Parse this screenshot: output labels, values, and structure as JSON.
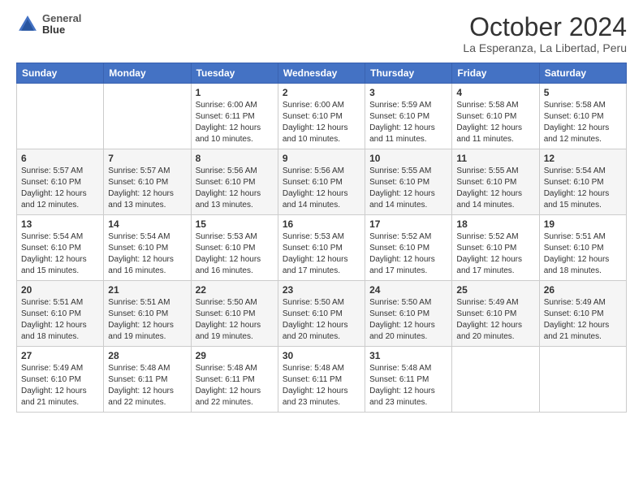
{
  "header": {
    "logo_line1": "General",
    "logo_line2": "Blue",
    "title": "October 2024",
    "subtitle": "La Esperanza, La Libertad, Peru"
  },
  "calendar": {
    "days_of_week": [
      "Sunday",
      "Monday",
      "Tuesday",
      "Wednesday",
      "Thursday",
      "Friday",
      "Saturday"
    ],
    "weeks": [
      [
        {
          "day": "",
          "sunrise": "",
          "sunset": "",
          "daylight": ""
        },
        {
          "day": "",
          "sunrise": "",
          "sunset": "",
          "daylight": ""
        },
        {
          "day": "1",
          "sunrise": "Sunrise: 6:00 AM",
          "sunset": "Sunset: 6:11 PM",
          "daylight": "Daylight: 12 hours and 10 minutes."
        },
        {
          "day": "2",
          "sunrise": "Sunrise: 6:00 AM",
          "sunset": "Sunset: 6:10 PM",
          "daylight": "Daylight: 12 hours and 10 minutes."
        },
        {
          "day": "3",
          "sunrise": "Sunrise: 5:59 AM",
          "sunset": "Sunset: 6:10 PM",
          "daylight": "Daylight: 12 hours and 11 minutes."
        },
        {
          "day": "4",
          "sunrise": "Sunrise: 5:58 AM",
          "sunset": "Sunset: 6:10 PM",
          "daylight": "Daylight: 12 hours and 11 minutes."
        },
        {
          "day": "5",
          "sunrise": "Sunrise: 5:58 AM",
          "sunset": "Sunset: 6:10 PM",
          "daylight": "Daylight: 12 hours and 12 minutes."
        }
      ],
      [
        {
          "day": "6",
          "sunrise": "Sunrise: 5:57 AM",
          "sunset": "Sunset: 6:10 PM",
          "daylight": "Daylight: 12 hours and 12 minutes."
        },
        {
          "day": "7",
          "sunrise": "Sunrise: 5:57 AM",
          "sunset": "Sunset: 6:10 PM",
          "daylight": "Daylight: 12 hours and 13 minutes."
        },
        {
          "day": "8",
          "sunrise": "Sunrise: 5:56 AM",
          "sunset": "Sunset: 6:10 PM",
          "daylight": "Daylight: 12 hours and 13 minutes."
        },
        {
          "day": "9",
          "sunrise": "Sunrise: 5:56 AM",
          "sunset": "Sunset: 6:10 PM",
          "daylight": "Daylight: 12 hours and 14 minutes."
        },
        {
          "day": "10",
          "sunrise": "Sunrise: 5:55 AM",
          "sunset": "Sunset: 6:10 PM",
          "daylight": "Daylight: 12 hours and 14 minutes."
        },
        {
          "day": "11",
          "sunrise": "Sunrise: 5:55 AM",
          "sunset": "Sunset: 6:10 PM",
          "daylight": "Daylight: 12 hours and 14 minutes."
        },
        {
          "day": "12",
          "sunrise": "Sunrise: 5:54 AM",
          "sunset": "Sunset: 6:10 PM",
          "daylight": "Daylight: 12 hours and 15 minutes."
        }
      ],
      [
        {
          "day": "13",
          "sunrise": "Sunrise: 5:54 AM",
          "sunset": "Sunset: 6:10 PM",
          "daylight": "Daylight: 12 hours and 15 minutes."
        },
        {
          "day": "14",
          "sunrise": "Sunrise: 5:54 AM",
          "sunset": "Sunset: 6:10 PM",
          "daylight": "Daylight: 12 hours and 16 minutes."
        },
        {
          "day": "15",
          "sunrise": "Sunrise: 5:53 AM",
          "sunset": "Sunset: 6:10 PM",
          "daylight": "Daylight: 12 hours and 16 minutes."
        },
        {
          "day": "16",
          "sunrise": "Sunrise: 5:53 AM",
          "sunset": "Sunset: 6:10 PM",
          "daylight": "Daylight: 12 hours and 17 minutes."
        },
        {
          "day": "17",
          "sunrise": "Sunrise: 5:52 AM",
          "sunset": "Sunset: 6:10 PM",
          "daylight": "Daylight: 12 hours and 17 minutes."
        },
        {
          "day": "18",
          "sunrise": "Sunrise: 5:52 AM",
          "sunset": "Sunset: 6:10 PM",
          "daylight": "Daylight: 12 hours and 17 minutes."
        },
        {
          "day": "19",
          "sunrise": "Sunrise: 5:51 AM",
          "sunset": "Sunset: 6:10 PM",
          "daylight": "Daylight: 12 hours and 18 minutes."
        }
      ],
      [
        {
          "day": "20",
          "sunrise": "Sunrise: 5:51 AM",
          "sunset": "Sunset: 6:10 PM",
          "daylight": "Daylight: 12 hours and 18 minutes."
        },
        {
          "day": "21",
          "sunrise": "Sunrise: 5:51 AM",
          "sunset": "Sunset: 6:10 PM",
          "daylight": "Daylight: 12 hours and 19 minutes."
        },
        {
          "day": "22",
          "sunrise": "Sunrise: 5:50 AM",
          "sunset": "Sunset: 6:10 PM",
          "daylight": "Daylight: 12 hours and 19 minutes."
        },
        {
          "day": "23",
          "sunrise": "Sunrise: 5:50 AM",
          "sunset": "Sunset: 6:10 PM",
          "daylight": "Daylight: 12 hours and 20 minutes."
        },
        {
          "day": "24",
          "sunrise": "Sunrise: 5:50 AM",
          "sunset": "Sunset: 6:10 PM",
          "daylight": "Daylight: 12 hours and 20 minutes."
        },
        {
          "day": "25",
          "sunrise": "Sunrise: 5:49 AM",
          "sunset": "Sunset: 6:10 PM",
          "daylight": "Daylight: 12 hours and 20 minutes."
        },
        {
          "day": "26",
          "sunrise": "Sunrise: 5:49 AM",
          "sunset": "Sunset: 6:10 PM",
          "daylight": "Daylight: 12 hours and 21 minutes."
        }
      ],
      [
        {
          "day": "27",
          "sunrise": "Sunrise: 5:49 AM",
          "sunset": "Sunset: 6:10 PM",
          "daylight": "Daylight: 12 hours and 21 minutes."
        },
        {
          "day": "28",
          "sunrise": "Sunrise: 5:48 AM",
          "sunset": "Sunset: 6:11 PM",
          "daylight": "Daylight: 12 hours and 22 minutes."
        },
        {
          "day": "29",
          "sunrise": "Sunrise: 5:48 AM",
          "sunset": "Sunset: 6:11 PM",
          "daylight": "Daylight: 12 hours and 22 minutes."
        },
        {
          "day": "30",
          "sunrise": "Sunrise: 5:48 AM",
          "sunset": "Sunset: 6:11 PM",
          "daylight": "Daylight: 12 hours and 23 minutes."
        },
        {
          "day": "31",
          "sunrise": "Sunrise: 5:48 AM",
          "sunset": "Sunset: 6:11 PM",
          "daylight": "Daylight: 12 hours and 23 minutes."
        },
        {
          "day": "",
          "sunrise": "",
          "sunset": "",
          "daylight": ""
        },
        {
          "day": "",
          "sunrise": "",
          "sunset": "",
          "daylight": ""
        }
      ]
    ]
  }
}
